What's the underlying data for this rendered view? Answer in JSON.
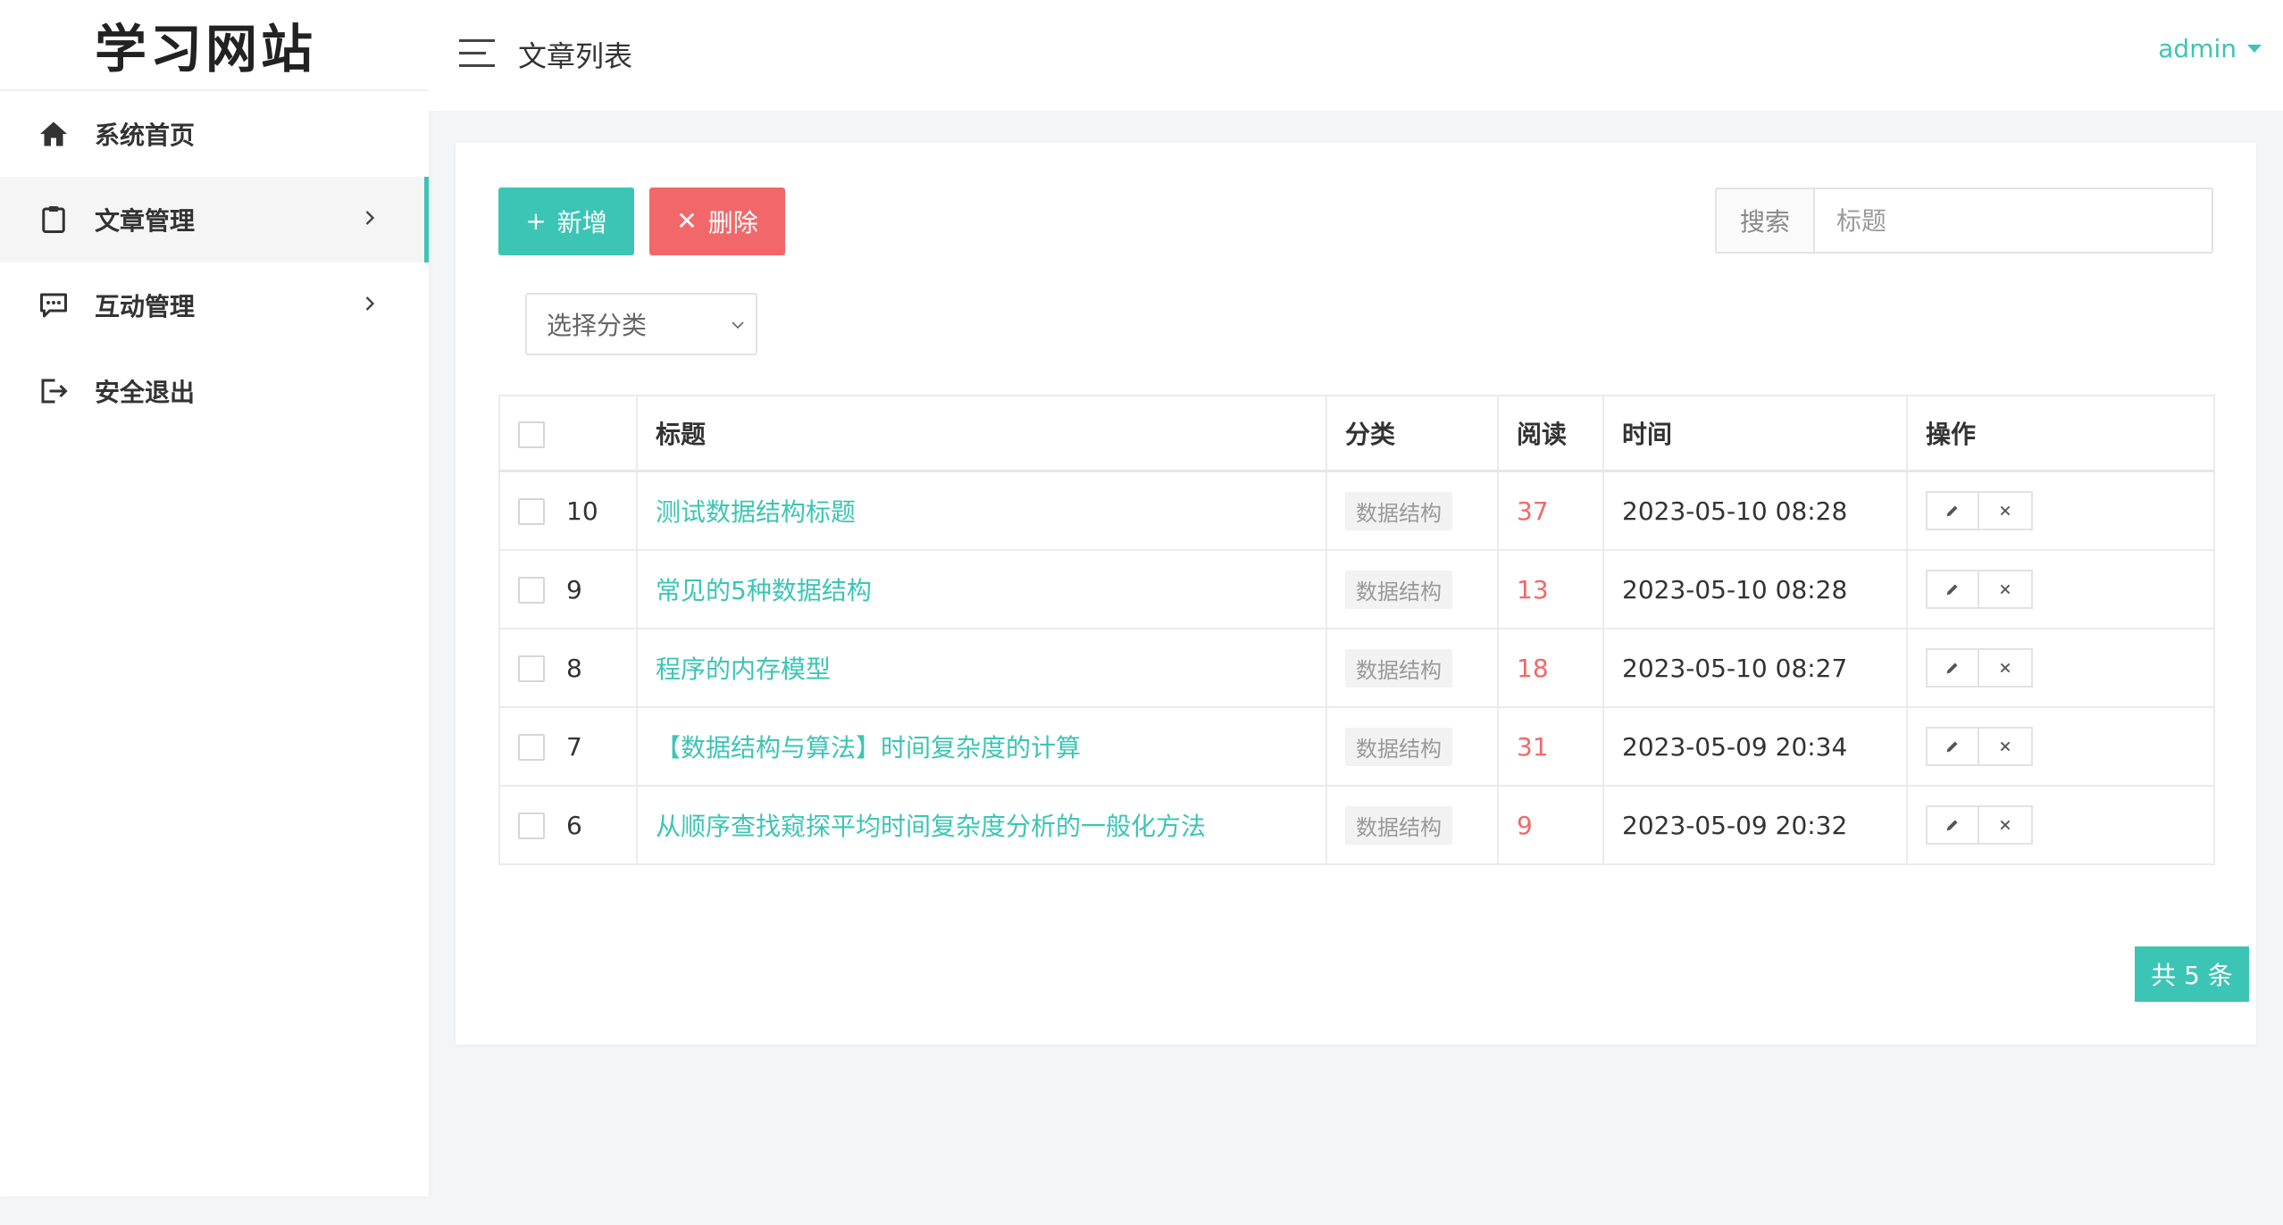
{
  "app": {
    "logo": "学习网站"
  },
  "sidebar": {
    "items": [
      {
        "label": "系统首页",
        "icon": "home-icon"
      },
      {
        "label": "文章管理",
        "icon": "clipboard-icon",
        "active": true,
        "has_children": true
      },
      {
        "label": "互动管理",
        "icon": "comment-icon",
        "has_children": true
      },
      {
        "label": "安全退出",
        "icon": "logout-icon"
      }
    ]
  },
  "header": {
    "title": "文章列表",
    "user": "admin"
  },
  "toolbar": {
    "add_label": "新增",
    "delete_label": "删除",
    "search_label": "搜索",
    "search_placeholder": "标题",
    "category_placeholder": "选择分类"
  },
  "table": {
    "headers": [
      "标题",
      "分类",
      "阅读",
      "时间",
      "操作"
    ],
    "rows": [
      {
        "id": "10",
        "title": "测试数据结构标题",
        "category": "数据结构",
        "reads": "37",
        "time": "2023-05-10 08:28"
      },
      {
        "id": "9",
        "title": "常见的5种数据结构",
        "category": "数据结构",
        "reads": "13",
        "time": "2023-05-10 08:28"
      },
      {
        "id": "8",
        "title": "程序的内存模型",
        "category": "数据结构",
        "reads": "18",
        "time": "2023-05-10 08:27"
      },
      {
        "id": "7",
        "title": "【数据结构与算法】时间复杂度的计算",
        "category": "数据结构",
        "reads": "31",
        "time": "2023-05-09 20:34"
      },
      {
        "id": "6",
        "title": "从顺序查找窥探平均时间复杂度分析的一般化方法",
        "category": "数据结构",
        "reads": "9",
        "time": "2023-05-09 20:32"
      }
    ]
  },
  "pagination": {
    "total_label": "共 5 条"
  },
  "colors": {
    "accent": "#3cc5b4",
    "danger": "#f2686a"
  }
}
